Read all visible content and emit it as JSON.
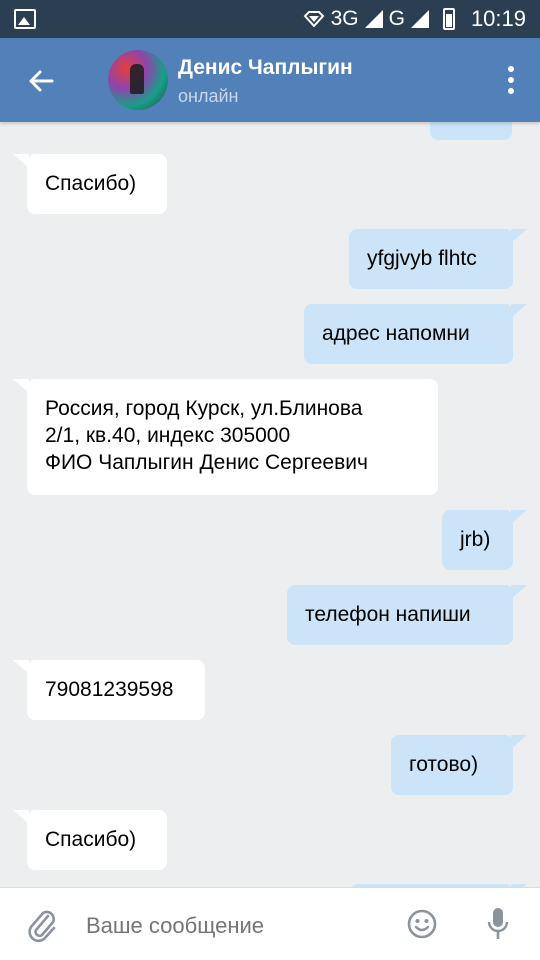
{
  "status_bar": {
    "network_1": "3G",
    "network_2": "G",
    "time": "10:19"
  },
  "header": {
    "contact_name": "Денис Чаплыгин",
    "status": "онлайн",
    "back_icon": "arrow-left-icon",
    "menu_icon": "more-vertical-icon"
  },
  "messages": [
    {
      "direction": "in",
      "text": "Спасибо)"
    },
    {
      "direction": "out",
      "text": "yfgjvyb flhtc"
    },
    {
      "direction": "out",
      "text": "адрес напомни"
    },
    {
      "direction": "in",
      "lines": [
        "Россия, город Курск, ул.Блинова",
        "2/1, кв.40, индекс 305000",
        "ФИО Чаплыгин Денис Сергеевич"
      ]
    },
    {
      "direction": "out",
      "text": "jrb)"
    },
    {
      "direction": "out",
      "text": "телефон напиши"
    },
    {
      "direction": "in",
      "text": "79081239598"
    },
    {
      "direction": "out",
      "text": "готово)"
    },
    {
      "direction": "in",
      "text": "Спасибо)"
    }
  ],
  "composer": {
    "placeholder": "Ваше сообщение",
    "attach_icon": "paperclip-icon",
    "emoji_icon": "smiley-icon",
    "mic_icon": "microphone-icon"
  },
  "colors": {
    "status_bar": "#2c3e52",
    "header": "#5181b8",
    "chat_bg": "#edeef0",
    "outgoing_bubble": "#cce4f7",
    "incoming_bubble": "#ffffff"
  }
}
